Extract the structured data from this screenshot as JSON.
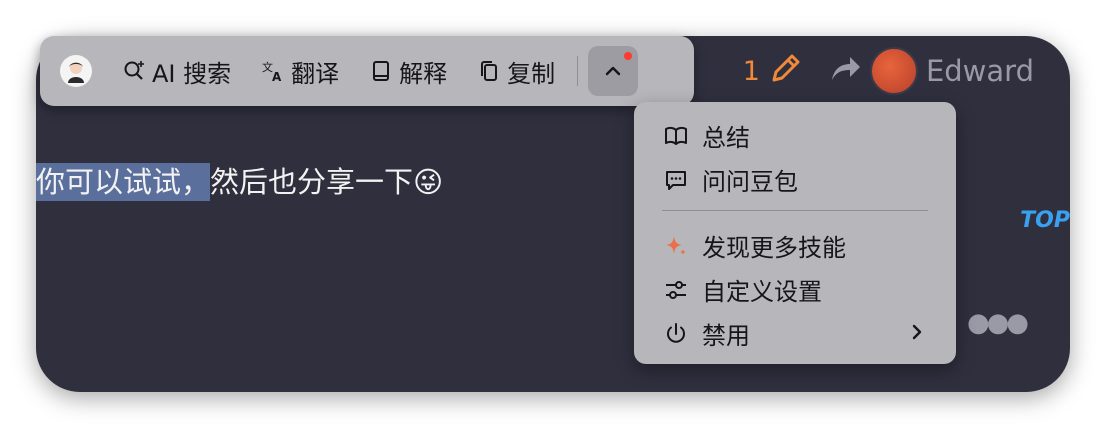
{
  "background": {
    "selected_text": "你可以试试，",
    "remaining_text": "然后也分享一下😜",
    "notification_count": "1",
    "username": "Edward",
    "top_label": "TOP"
  },
  "toolbar": {
    "ai_search": "AI 搜索",
    "translate": "翻译",
    "explain": "解释",
    "copy": "复制"
  },
  "menu": {
    "items": [
      {
        "label": "总结",
        "icon": "book-open-icon"
      },
      {
        "label": "问问豆包",
        "icon": "chat-bubble-icon"
      },
      {
        "label": "发现更多技能",
        "icon": "sparkle-icon"
      },
      {
        "label": "自定义设置",
        "icon": "sliders-icon"
      },
      {
        "label": "禁用",
        "icon": "power-icon"
      }
    ]
  },
  "colors": {
    "accent": "#f08a3a",
    "sparkle": "#e8704a",
    "background": "#2f2f3e",
    "toolbar": "#b7b7bb"
  }
}
